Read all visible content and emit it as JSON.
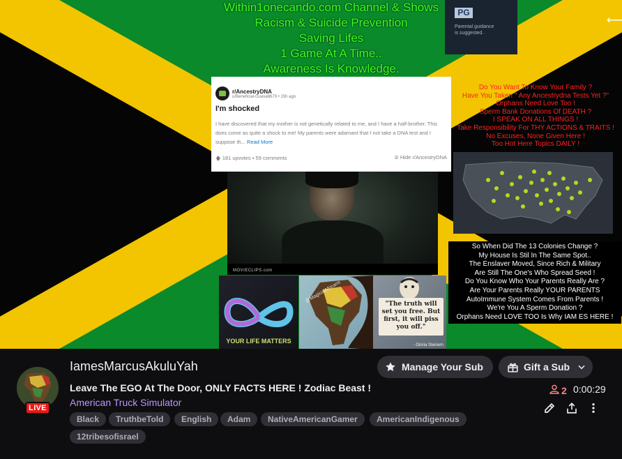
{
  "overlay": {
    "headline_lines": [
      "Within1onecando.com Channel & Shows",
      "Racism & Suicide Prevention",
      "Saving Lifes",
      "1 Game At A Time..",
      "Awareness Is Knowledge."
    ],
    "pg_badge": "PG",
    "pg_text_lines": [
      "Parental guidance",
      "is suggested."
    ],
    "reddit": {
      "subreddit": "r/AncestryDNA",
      "meta": "u/Beneficial-Guava8679 • 15h ago",
      "title": "I'm shocked",
      "body": "I have discovered that my mother is not genetically related to me, and I have a half-brother. This does come as quite a shock to me! My parents were adamant that I not take a DNA test and I suppose th...",
      "read_more": "Read More",
      "upvotes": "181 upvotes",
      "comments": "59 comments",
      "hide": "Hide r/AncestryDNA"
    },
    "movie_logo": "MOVIECLIPS.com",
    "tile_life_caption": "YOUR LIFE MATTERS",
    "tile_africa_caption": "@MagicalAfricans",
    "truth_quote": "\"The truth will set you free. But first, it will piss you off.\"",
    "truth_author": "- Gloria Steinem",
    "red_lines": [
      "Do You Want To Know Your Family ?",
      "Have You Taken \" Any Ancestrydna Tests Yet ?\"",
      "Orphans Need Love Too !",
      "Sperm Bank Donations Of DEATH ?",
      "I SPEAK ON ALL THINGS !",
      "Take Responsibility For THY ACTIONS & TRAITS !",
      "No Excuses, None Given Here !",
      "Too Hot Here Topics DAILY !"
    ],
    "white_lines": [
      "So When Did The 13 Colonies Change ?",
      "My House Is Stil In The Same Spot..",
      "The Enslaver Moved, Since Rich & Military",
      "Are Still The One's Who Spread Seed !",
      "Do You Know Who Your Parents Really Are ?",
      "Are Your Parents Really YOUR PARENTS",
      "AutoImmune System Comes From Parents !",
      "We're You A Sperm Donation ?",
      "Orphans Need LOVE TOO Is Why IAM ES HERE !"
    ],
    "collapse_icon": "collapse-arrow-icon"
  },
  "info": {
    "channel_name": "IamesMarcusAkuluYah",
    "live_label": "LIVE",
    "stream_title": "Leave The EGO At The Door, ONLY FACTS HERE ! Zodiac Beast !",
    "game": "American Truck Simulator",
    "tags": [
      "Black",
      "TruthbeTold",
      "English",
      "Adam",
      "NativeAmericanGamer",
      "AmericanIndigenous",
      "12tribesofisrael"
    ],
    "manage_sub_label": "Manage Your Sub",
    "gift_sub_label": "Gift a Sub",
    "viewer_count": "2",
    "uptime": "0:00:29",
    "colors": {
      "accent": "#bf94ff",
      "live": "#e91916",
      "viewers": "#ff8280"
    }
  }
}
